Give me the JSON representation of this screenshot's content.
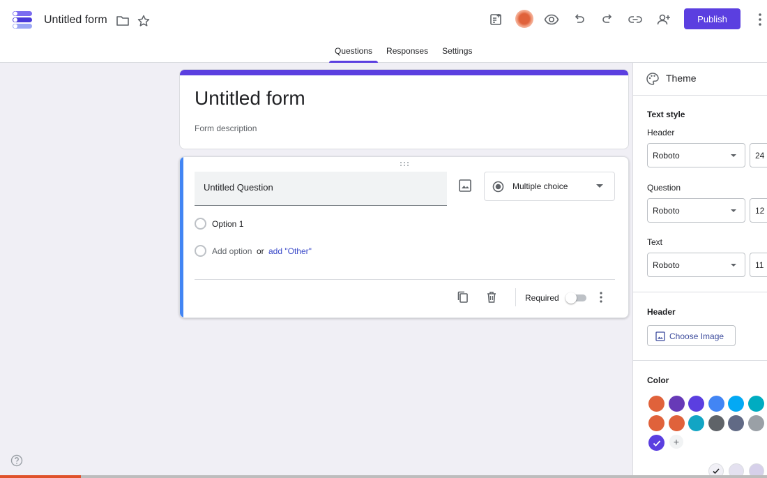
{
  "app": {
    "doc_title": "Untitled form",
    "publish_label": "Publish"
  },
  "tabs": [
    {
      "label": "Questions",
      "active": true
    },
    {
      "label": "Responses",
      "active": false
    },
    {
      "label": "Settings",
      "active": false
    }
  ],
  "form": {
    "title": "Untitled form",
    "description_placeholder": "Form description",
    "accent_color": "#5b3fe0"
  },
  "question": {
    "title": "Untitled Question",
    "type": "Multiple choice",
    "options": [
      "Option 1"
    ],
    "add_option_label": "Add option",
    "or_label": "or",
    "add_other_label": "add \"Other\"",
    "required_label": "Required",
    "required": false
  },
  "theme_panel": {
    "title": "Theme",
    "text_style_label": "Text style",
    "header_label": "Header",
    "header_font": "Roboto",
    "header_size": "24",
    "question_label": "Question",
    "question_font": "Roboto",
    "question_size": "12",
    "text_label": "Text",
    "text_font": "Roboto",
    "text_size": "11",
    "header_section_label": "Header",
    "choose_image_label": "Choose Image",
    "color_label": "Color",
    "colors": [
      "#e0623b",
      "#673ab7",
      "#5b3fe0",
      "#4285f4",
      "#03a9f4",
      "#00acc1",
      "#e0623b",
      "#e0623b",
      "#12a5c4",
      "#5f6368",
      "#616a85",
      "#9aa0a6"
    ],
    "selected_color": "#5b3fe0",
    "background_colors": [
      "#f1f0f6",
      "#e4e1f0",
      "#d6d0ea"
    ]
  },
  "progress_fraction": 0.105,
  "progress_color": "#e0522b"
}
